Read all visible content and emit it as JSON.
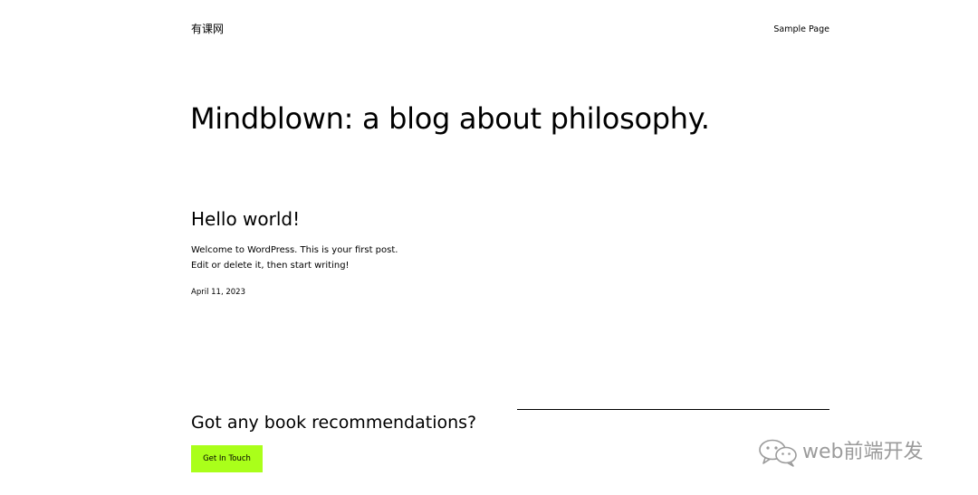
{
  "header": {
    "site_title": "有课网",
    "nav": [
      {
        "label": "Sample Page"
      }
    ]
  },
  "hero": {
    "title": "Mindblown: a blog about philosophy."
  },
  "post": {
    "title": "Hello world!",
    "excerpt_line1": "Welcome to WordPress. This is your first post.",
    "excerpt_line2": "Edit or delete it, then start writing!",
    "date": "April 11, 2023"
  },
  "footer": {
    "heading": "Got any book recommendations?",
    "button_label": "Get In Touch",
    "button_color": "#aaff1a"
  },
  "watermark": {
    "text": "web前端开发",
    "icon": "wechat-icon"
  }
}
